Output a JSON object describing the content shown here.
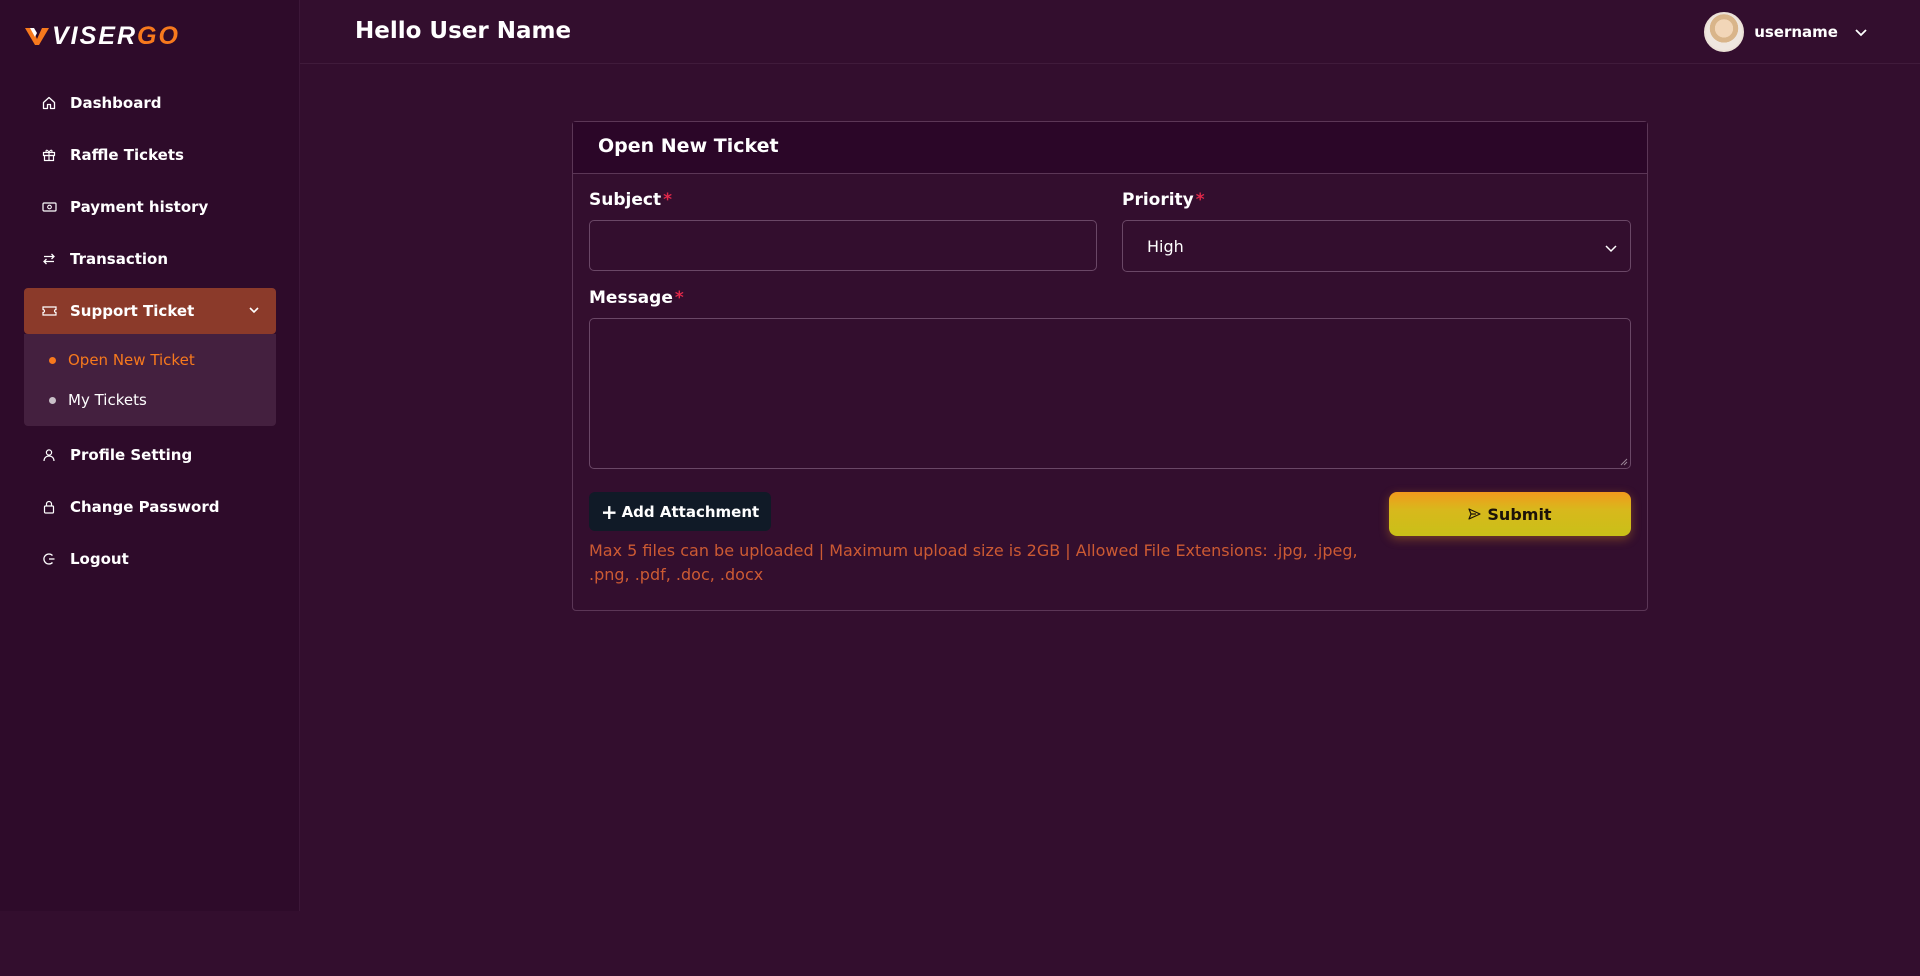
{
  "brand": {
    "logo_white": "VISER",
    "logo_accent": "GO",
    "accent_color": "#f7791d"
  },
  "sidebar": {
    "items": [
      {
        "label": "Dashboard",
        "icon": "home-icon"
      },
      {
        "label": "Raffle Tickets",
        "icon": "gift-icon"
      },
      {
        "label": "Payment history",
        "icon": "money-icon"
      },
      {
        "label": "Transaction",
        "icon": "transfer-icon"
      },
      {
        "label": "Support Ticket",
        "icon": "ticket-icon",
        "active": true,
        "expanded": true
      },
      {
        "label": "Profile Setting",
        "icon": "user-icon"
      },
      {
        "label": "Change Password",
        "icon": "lock-icon"
      },
      {
        "label": "Logout",
        "icon": "logout-icon"
      }
    ],
    "support_submenu": [
      {
        "label": "Open New Ticket",
        "current": true
      },
      {
        "label": "My Tickets",
        "current": false
      }
    ]
  },
  "header": {
    "greeting": "Hello User Name",
    "username": "username"
  },
  "form": {
    "title": "Open New Ticket",
    "subject_label": "Subject",
    "subject_value": "",
    "priority_label": "Priority",
    "priority_value": "High",
    "message_label": "Message",
    "message_value": "",
    "required_mark": "*",
    "attach_label": "Add Attachment",
    "submit_label": "Submit",
    "upload_note": "Max 5 files can be uploaded | Maximum upload size is 2GB | Allowed File Extensions: .jpg, .jpeg, .png, .pdf, .doc, .docx"
  },
  "colors": {
    "background": "#330e2e",
    "sidebar_bg": "#2e0b2a",
    "active_item": "#8b3a2a",
    "required": "#e0284a",
    "note_text": "#cc5a33",
    "submit_gradient_top": "#f29a1d",
    "submit_gradient_bottom": "#c9c018"
  }
}
